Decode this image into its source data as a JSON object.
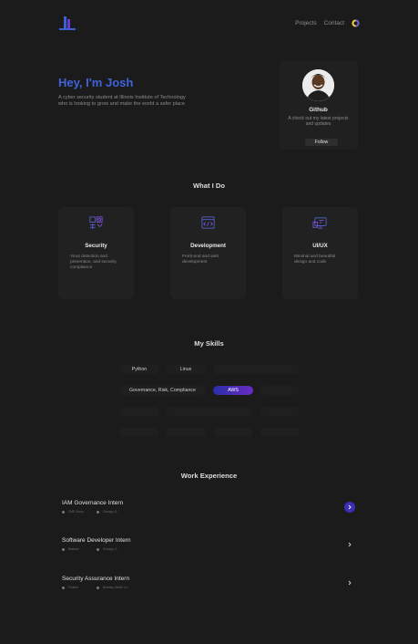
{
  "header": {
    "nav": [
      {
        "label": "Projects"
      },
      {
        "label": "Contact"
      }
    ],
    "logo_icon": "bar-logo",
    "theme_icon": "sun-moon-icon"
  },
  "hero": {
    "title": "Hey, I'm Josh",
    "description": "A cyber security student at Illinois Institute of Technology who is looking to grow and make the world a safer place"
  },
  "github_card": {
    "title": "Github",
    "description": "A check out my latest projects and updates",
    "follow_label": "Follow"
  },
  "services": {
    "heading": "What I Do",
    "items": [
      {
        "title": "Security",
        "description": "Virus detection and prevention, and security compliance",
        "icon": "security-icon"
      },
      {
        "title": "Development",
        "description": "Front end and web development",
        "icon": "code-window-icon"
      },
      {
        "title": "UI/UX",
        "description": "Minimal and beautiful design and code",
        "icon": "design-monitor-icon"
      }
    ]
  },
  "skills": {
    "heading": "My Skills",
    "items": [
      "Python",
      "Linux",
      "Governance, Risk, Compliance",
      "AWS"
    ],
    "selected": "AWS"
  },
  "work": {
    "heading": "Work Experience",
    "items": [
      {
        "title": "IAM Governance Intern",
        "company": "CME Group",
        "location": "Chicago, IL"
      },
      {
        "title": "Software Developer Intern",
        "company": "Braviant",
        "location": "Chicago, IL"
      },
      {
        "title": "Security Assurance Intern",
        "company": "Fortinet",
        "location": "Burnaby, British Co."
      }
    ]
  },
  "colors": {
    "accent": "#3f63dc",
    "background": "#1b1b1b",
    "card": "#212121",
    "pill_active_start": "#2a2fa8",
    "pill_active_end": "#6a2bc4"
  }
}
